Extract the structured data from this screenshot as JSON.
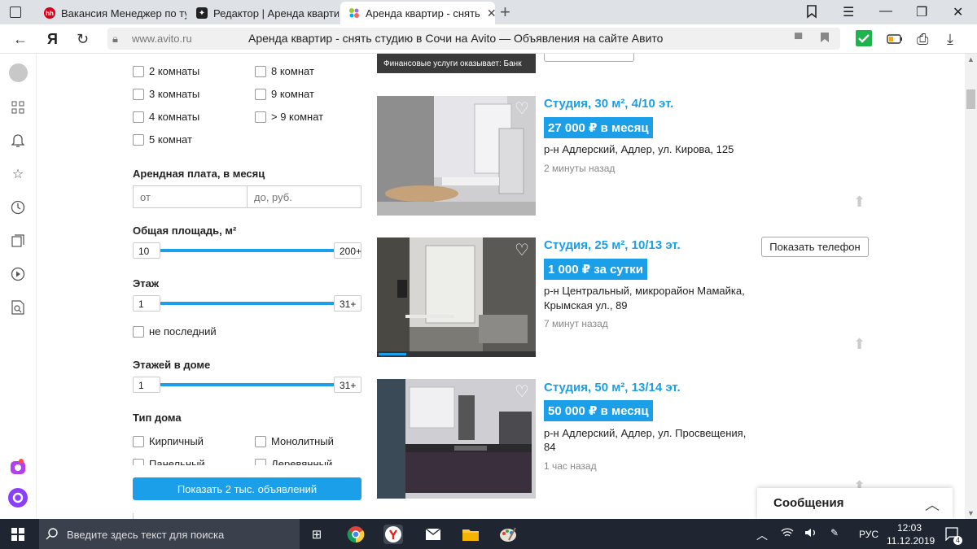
{
  "browser": {
    "tabs": [
      {
        "title": "Вакансия Менеджер по ту",
        "icon": "hh-icon"
      },
      {
        "title": "Редактор | Аренда квартир",
        "icon": "editor-icon"
      },
      {
        "title": "Аренда квартир - снять",
        "icon": "avito-icon",
        "active": true
      }
    ],
    "url_host": "www.avito.ru",
    "page_title": "Аренда квартир - снять студию в Сочи на Avito — Объявления на сайте Авито"
  },
  "filters": {
    "rooms": [
      {
        "left": "2 комнаты",
        "right": "8 комнат"
      },
      {
        "left": "3 комнаты",
        "right": "9 комнат"
      },
      {
        "left": "4 комнаты",
        "right": "> 9 комнат"
      },
      {
        "left": "5 комнат",
        "right": ""
      }
    ],
    "rent_title": "Арендная плата, в месяц",
    "rent_from_placeholder": "от",
    "rent_to_placeholder": "до, руб.",
    "area_title": "Общая площадь, м²",
    "area_min": "10",
    "area_max": "200+",
    "floor_title": "Этаж",
    "floor_min": "1",
    "floor_max": "31+",
    "not_last_label": "не последний",
    "floors_title": "Этажей в доме",
    "floors_min": "1",
    "floors_max": "31+",
    "house_type_title": "Тип дома",
    "house_types": [
      {
        "left": "Кирпичный",
        "right": "Монолитный"
      },
      {
        "left": "Панельный",
        "right": "Деревянный"
      }
    ],
    "show_button": "Показать 2 тыс. объявлений"
  },
  "banner_text": "Финансовые услуги оказывает: Банк",
  "listings": [
    {
      "title": "Студия, 30 м², 4/10 эт.",
      "price": "27 000 ₽ в месяц",
      "address_line1": "р-н Адлерский, Адлер, ул. Кирова, 125",
      "address_line2": "",
      "time": "2 минуты назад"
    },
    {
      "title": "Студия, 25 м², 10/13 эт.",
      "price": "1 000 ₽ за сутки",
      "address_line1": "р-н Центральный, микрорайон Мамайка,",
      "address_line2": "Крымская ул., 89",
      "time": "7 минут назад"
    },
    {
      "title": "Студия, 50 м², 13/14 эт.",
      "price": "50 000 ₽ в месяц",
      "address_line1": "р-н Адлерский, Адлер, ул. Просвещения,",
      "address_line2": "84",
      "time": "1 час назад"
    }
  ],
  "phone_button": "Показать телефон",
  "messages_label": "Сообщения",
  "taskbar": {
    "search_placeholder": "Введите здесь текст для поиска",
    "lang": "РУС",
    "time": "12:03",
    "date": "11.12.2019",
    "notif_count": "4"
  },
  "colors": {
    "accent": "#1a9fe8",
    "taskbar": "#1f2632"
  }
}
